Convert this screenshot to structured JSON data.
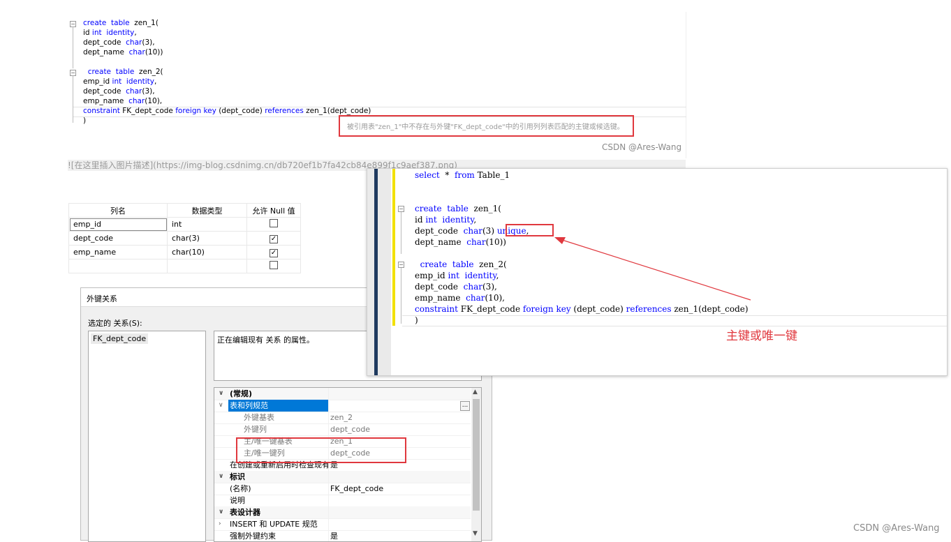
{
  "top_code": [
    [
      {
        "t": "create",
        "c": "kw"
      },
      {
        "t": "  "
      },
      {
        "t": "table",
        "c": "kw"
      },
      {
        "t": "  zen_1("
      }
    ],
    [
      {
        "t": "id "
      },
      {
        "t": "int",
        "c": "kw"
      },
      {
        "t": "  "
      },
      {
        "t": "identity",
        "c": "kw"
      },
      {
        "t": ","
      }
    ],
    [
      {
        "t": "dept_code  "
      },
      {
        "t": "char",
        "c": "kw"
      },
      {
        "t": "(3),"
      }
    ],
    [
      {
        "t": "dept_name  "
      },
      {
        "t": "char",
        "c": "kw"
      },
      {
        "t": "(10))"
      }
    ],
    [],
    [
      {
        "t": "  "
      },
      {
        "t": "create",
        "c": "kw"
      },
      {
        "t": "  "
      },
      {
        "t": "table",
        "c": "kw"
      },
      {
        "t": "  zen_2("
      }
    ],
    [
      {
        "t": "emp_id "
      },
      {
        "t": "int",
        "c": "kw"
      },
      {
        "t": "  "
      },
      {
        "t": "identity",
        "c": "kw"
      },
      {
        "t": ","
      }
    ],
    [
      {
        "t": "dept_code  "
      },
      {
        "t": "char",
        "c": "kw"
      },
      {
        "t": "(3),"
      }
    ],
    [
      {
        "t": "emp_name  "
      },
      {
        "t": "char",
        "c": "kw"
      },
      {
        "t": "(10),"
      }
    ],
    [
      {
        "t": "constraint",
        "c": "kw"
      },
      {
        "t": " FK_dept_code "
      },
      {
        "t": "foreign key",
        "c": "kw"
      },
      {
        "t": " (dept_code) "
      },
      {
        "t": "references",
        "c": "kw"
      },
      {
        "t": " zen_1(dept_code)"
      }
    ],
    [
      {
        "t": ")"
      }
    ]
  ],
  "error_message": "被引用表\"zen_1\"中不存在与外键\"FK_dept_code\"中的引用列列表匹配的主键或候选键。",
  "watermark_top": "CSDN @Ares-Wang",
  "image_markdown": "![在这里插入图片描述](https://img-blog.csdnimg.cn/db720ef1b7fa42cb84e899f1c9aef387.png)",
  "column_table": {
    "headers": [
      "列名",
      "数据类型",
      "允许 Null 值"
    ],
    "rows": [
      {
        "name": "emp_id",
        "type": "int",
        "nullable": false
      },
      {
        "name": "dept_code",
        "type": "char(3)",
        "nullable": true
      },
      {
        "name": "emp_name",
        "type": "char(10)",
        "nullable": true
      },
      {
        "name": "",
        "type": "",
        "nullable": false
      }
    ]
  },
  "fk_dialog": {
    "title": "外键关系",
    "selected_label": "选定的 关系(S):",
    "list_item": "FK_dept_code",
    "description": "正在编辑现有 关系 的属性。",
    "props": [
      {
        "label": "(常规)",
        "value": "",
        "kind": "section"
      },
      {
        "label": "表和列规范",
        "value": "",
        "kind": "selected"
      },
      {
        "label": "外键基表",
        "value": "zen_2",
        "kind": "sub"
      },
      {
        "label": "外键列",
        "value": "dept_code",
        "kind": "sub"
      },
      {
        "label": "主/唯一键基表",
        "value": "zen_1",
        "kind": "sub"
      },
      {
        "label": "主/唯一键列",
        "value": "dept_code",
        "kind": "sub"
      },
      {
        "label": "在创建或重新启用时检查现有",
        "value": "是",
        "kind": "item"
      },
      {
        "label": "标识",
        "value": "",
        "kind": "section"
      },
      {
        "label": "(名称)",
        "value": "FK_dept_code",
        "kind": "item"
      },
      {
        "label": "说明",
        "value": "",
        "kind": "item"
      },
      {
        "label": "表设计器",
        "value": "",
        "kind": "section"
      },
      {
        "label": "INSERT 和 UPDATE 规范",
        "value": "",
        "kind": "collapsed"
      },
      {
        "label": "强制外键约束",
        "value": "是",
        "kind": "item"
      }
    ],
    "ellipsis": "..."
  },
  "right_code": [
    [
      {
        "t": "select",
        "c": "kw"
      },
      {
        "t": "  *  "
      },
      {
        "t": "from",
        "c": "kw"
      },
      {
        "t": " Table_1"
      }
    ],
    [],
    [],
    [
      {
        "t": "create",
        "c": "kw"
      },
      {
        "t": "  "
      },
      {
        "t": "table",
        "c": "kw"
      },
      {
        "t": "  zen_1("
      }
    ],
    [
      {
        "t": "id "
      },
      {
        "t": "int",
        "c": "kw"
      },
      {
        "t": "  "
      },
      {
        "t": "identity",
        "c": "kw"
      },
      {
        "t": ","
      }
    ],
    [
      {
        "t": "dept_code  "
      },
      {
        "t": "char",
        "c": "kw"
      },
      {
        "t": "(3) "
      },
      {
        "t": "unique",
        "c": "kw"
      },
      {
        "t": ","
      }
    ],
    [
      {
        "t": "dept_name  "
      },
      {
        "t": "char",
        "c": "kw"
      },
      {
        "t": "(10))"
      }
    ],
    [],
    [
      {
        "t": "  "
      },
      {
        "t": "create",
        "c": "kw"
      },
      {
        "t": "  "
      },
      {
        "t": "table",
        "c": "kw"
      },
      {
        "t": "  zen_2("
      }
    ],
    [
      {
        "t": "emp_id "
      },
      {
        "t": "int",
        "c": "kw"
      },
      {
        "t": "  "
      },
      {
        "t": "identity",
        "c": "kw"
      },
      {
        "t": ","
      }
    ],
    [
      {
        "t": "dept_code  "
      },
      {
        "t": "char",
        "c": "kw"
      },
      {
        "t": "(3),"
      }
    ],
    [
      {
        "t": "emp_name  "
      },
      {
        "t": "char",
        "c": "kw"
      },
      {
        "t": "(10),"
      }
    ],
    [
      {
        "t": "constraint",
        "c": "kw"
      },
      {
        "t": " FK_dept_code "
      },
      {
        "t": "foreign key",
        "c": "kw"
      },
      {
        "t": " (dept_code) "
      },
      {
        "t": "references",
        "c": "kw"
      },
      {
        "t": " zen_1(dept_code)"
      }
    ],
    [
      {
        "t": ")"
      }
    ]
  ],
  "annotation": "主键或唯一键",
  "watermark_bottom": "CSDN @Ares-Wang",
  "colors": {
    "keyword": "#0000ff",
    "highlight_red": "#e0383e",
    "annotation": "#e0383e"
  }
}
